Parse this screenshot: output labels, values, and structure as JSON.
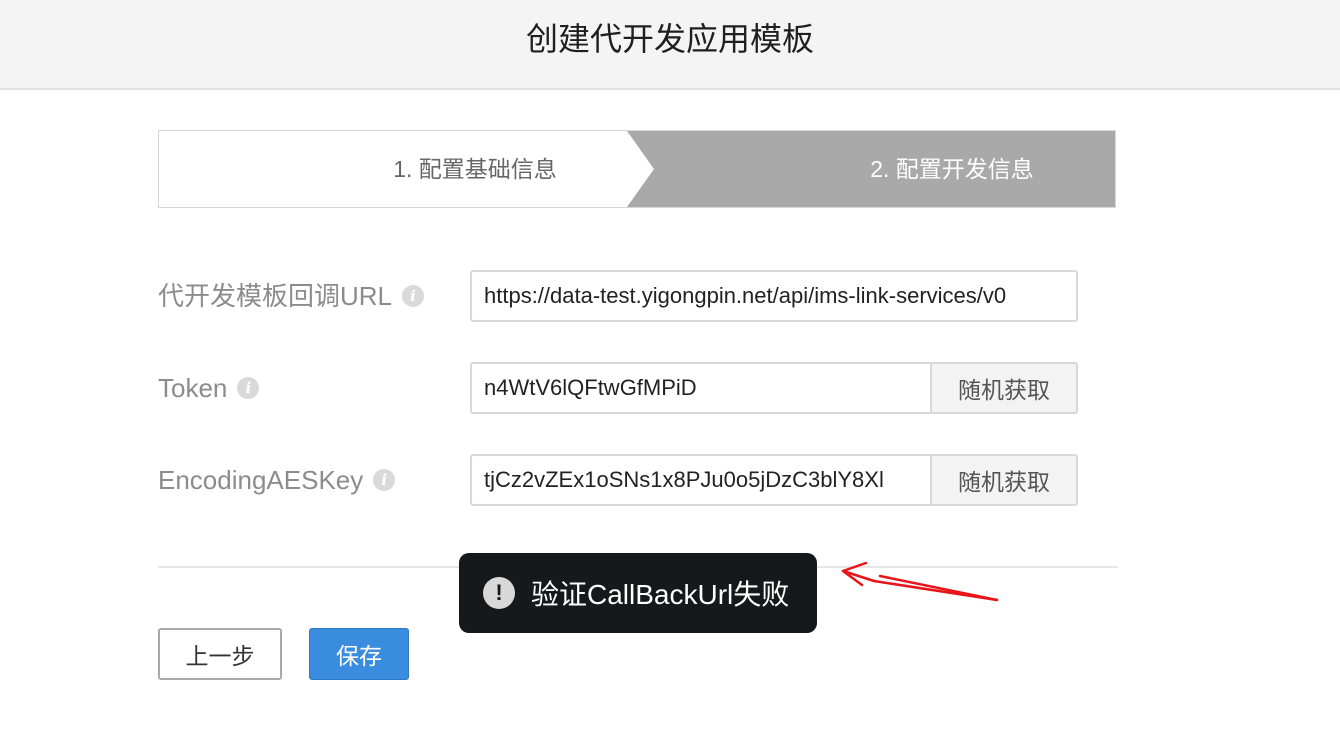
{
  "header": {
    "title": "创建代开发应用模板"
  },
  "steps": [
    {
      "label": "1. 配置基础信息",
      "active": false
    },
    {
      "label": "2. 配置开发信息",
      "active": true
    }
  ],
  "form": {
    "callback_url": {
      "label": "代开发模板回调URL",
      "value": "https://data-test.yigongpin.net/api/ims-link-services/v0"
    },
    "token": {
      "label": "Token",
      "value": "n4WtV6lQFtwGfMPiD",
      "button": "随机获取"
    },
    "aes_key": {
      "label": "EncodingAESKey",
      "value": "tjCz2vZEx1oSNs1x8PJu0o5jDzC3blY8Xl",
      "button": "随机获取"
    }
  },
  "actions": {
    "prev": "上一步",
    "save": "保存"
  },
  "toast": {
    "message": "验证CallBackUrl失败",
    "icon": "exclamation-icon"
  },
  "colors": {
    "active_step": "#a9a9a9",
    "primary": "#3a8dde",
    "toast_bg": "#17181b",
    "annotation": "#e8141a"
  }
}
